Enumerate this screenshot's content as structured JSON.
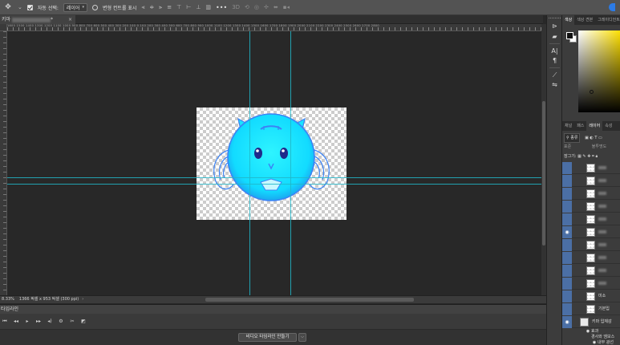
{
  "options_bar": {
    "move_tool_icon": "move-icon",
    "auto_select_label": "자동 선택:",
    "auto_select_value": "레이어",
    "show_transform_label": "변형 컨트롤 표시",
    "more_label": "•••"
  },
  "document": {
    "tab_title": "키마",
    "tab_suffix": "*",
    "tab_close": "×"
  },
  "ruler": {
    "numbers": "1600  1500  1400  1300  1200  1100  1000  900  800  700  600  500  400  300  200  100  0  100  200  300  400  500  600  700  800  900  1000  1100  1200  1300  1400  1500  1600  1700  1800  1900  2000  2100  2200  2300  2400  2500  2600  2700  2800"
  },
  "status_bar": {
    "zoom": "8.33%",
    "info": "1366 픽셀 x 953 픽셀 (300 ppi)",
    "arrow": "›"
  },
  "timeline": {
    "title": "타임라인",
    "create_button": "비디오 타임라인 만들기",
    "create_caret": "⌵"
  },
  "panels": {
    "color_tabs": [
      "색상",
      "색상 견본",
      "그레이디언트",
      "패턴"
    ],
    "layer_tabs": [
      "채널",
      "패스",
      "레이어",
      "속성"
    ],
    "filter_label": "종류",
    "blend_mode": "표준",
    "opacity_label": "불투명도",
    "lock_label": "잠그기:"
  },
  "layers": [
    {
      "name": "",
      "eye": false,
      "folder": false
    },
    {
      "name": "",
      "eye": false,
      "folder": false
    },
    {
      "name": "",
      "eye": false,
      "folder": false
    },
    {
      "name": "",
      "eye": false,
      "folder": false
    },
    {
      "name": "",
      "eye": false,
      "folder": false
    },
    {
      "name": "",
      "eye": true,
      "folder": false
    },
    {
      "name": "",
      "eye": false,
      "folder": false
    },
    {
      "name": "",
      "eye": false,
      "folder": false
    },
    {
      "name": "",
      "eye": false,
      "folder": false
    },
    {
      "name": "",
      "eye": false,
      "folder": false
    },
    {
      "name": "미소",
      "eye": false,
      "folder": false
    },
    {
      "name": "기본입",
      "eye": false,
      "folder": false
    },
    {
      "name": "키마 입체감",
      "eye": true,
      "folder": true
    }
  ],
  "effects": {
    "fx_label": "효과",
    "items": [
      "경사와 엠보스",
      "내부 광선"
    ]
  },
  "colors": {
    "guide": "#21b6c8",
    "mascot_body": "#19e5ff",
    "mascot_outline": "#3b83f5",
    "accent_blue": "#2c7be5"
  }
}
